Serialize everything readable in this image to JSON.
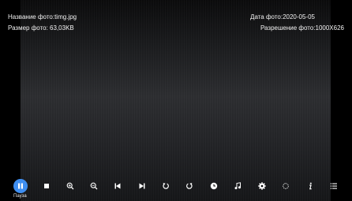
{
  "info": {
    "photo_name": "Название фото:timg.jpg",
    "photo_size": "Размер фото: 63,03KB",
    "photo_date": "Дата фото:2020-05-05",
    "photo_resolution": "Разрешение фото:1000X626"
  },
  "toolbar": {
    "pause_label": "Пауза",
    "buttons": [
      {
        "icon": "pause-icon"
      },
      {
        "icon": "stop-icon"
      },
      {
        "icon": "zoom-in-icon"
      },
      {
        "icon": "zoom-out-icon"
      },
      {
        "icon": "previous-icon"
      },
      {
        "icon": "next-icon"
      },
      {
        "icon": "rotate-left-icon"
      },
      {
        "icon": "rotate-right-icon"
      },
      {
        "icon": "clock-icon"
      },
      {
        "icon": "music-icon"
      },
      {
        "icon": "settings-icon"
      },
      {
        "icon": "circle-icon"
      },
      {
        "icon": "info-icon"
      },
      {
        "icon": "list-icon"
      }
    ]
  },
  "colors": {
    "accent": "#3f8ff2",
    "background": "#000000"
  }
}
